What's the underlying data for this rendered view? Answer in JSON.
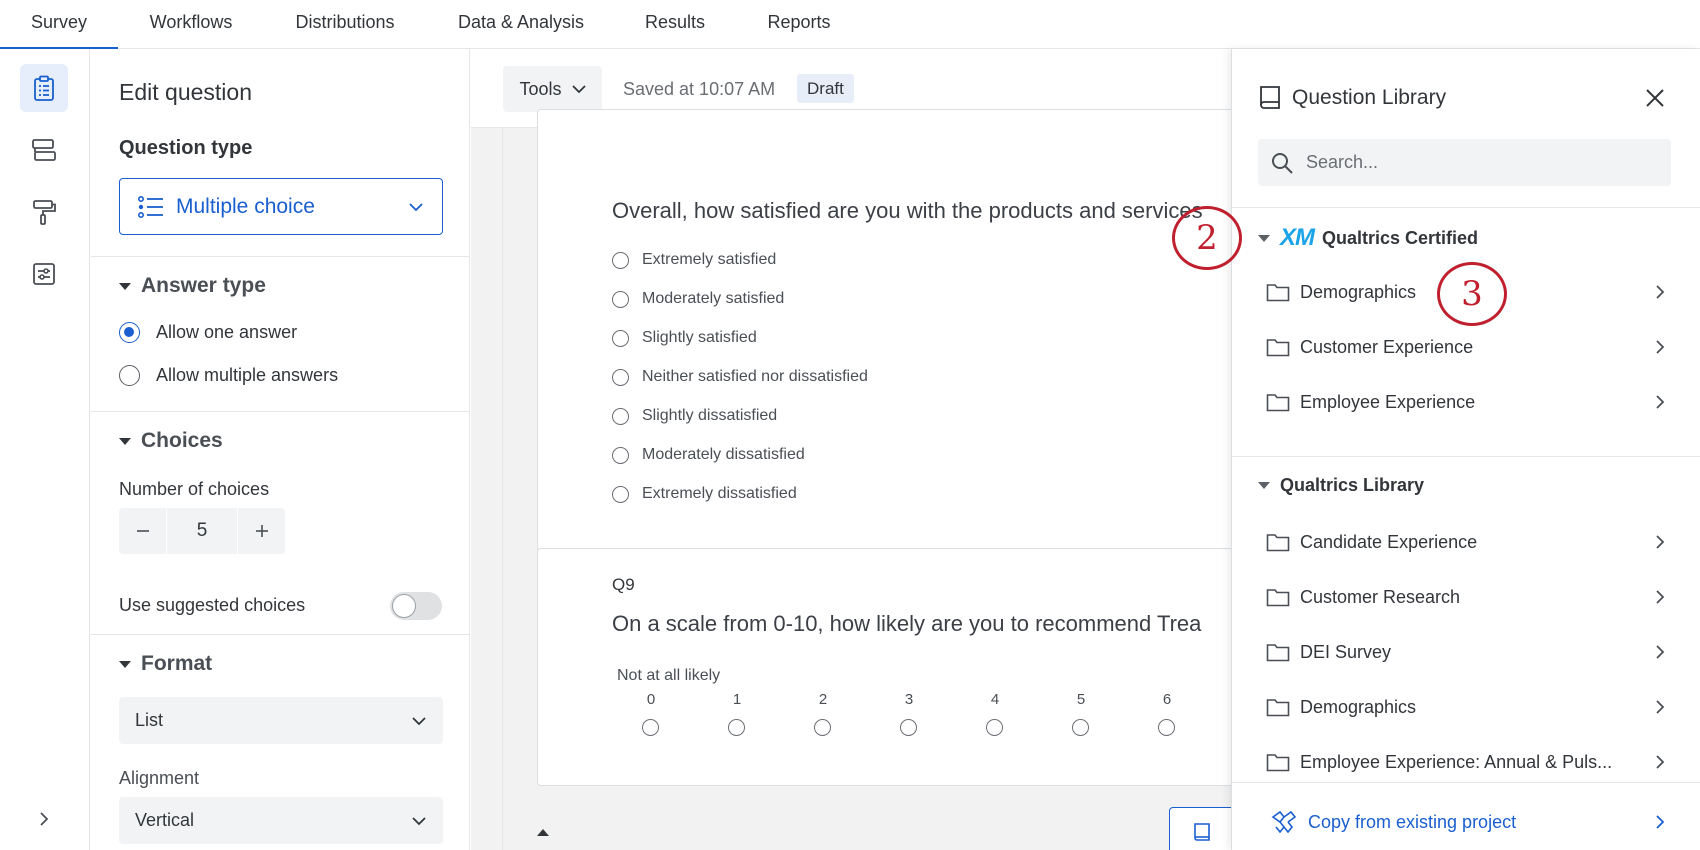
{
  "nav": {
    "tabs": [
      {
        "label": "Survey"
      },
      {
        "label": "Workflows"
      },
      {
        "label": "Distributions"
      },
      {
        "label": "Data & Analysis"
      },
      {
        "label": "Results"
      },
      {
        "label": "Reports"
      }
    ]
  },
  "edit": {
    "title": "Edit question",
    "question_type_label": "Question type",
    "question_type_value": "Multiple choice",
    "answer_type": {
      "heading": "Answer type",
      "options": [
        "Allow one answer",
        "Allow multiple answers"
      ],
      "selected": "Allow one answer"
    },
    "choices": {
      "heading": "Choices",
      "count_label": "Number of choices",
      "count_value": "5",
      "suggested_label": "Use suggested choices"
    },
    "format": {
      "heading": "Format",
      "value": "List",
      "alignment_label": "Alignment",
      "alignment_value": "Vertical"
    }
  },
  "toolbar": {
    "tools_label": "Tools",
    "saved_text": "Saved at 10:07 AM",
    "status_badge": "Draft"
  },
  "q8": {
    "text": "Overall, how satisfied are you with the products and services",
    "choices": [
      "Extremely satisfied",
      "Moderately satisfied",
      "Slightly satisfied",
      "Neither satisfied nor dissatisfied",
      "Slightly dissatisfied",
      "Moderately dissatisfied",
      "Extremely dissatisfied"
    ]
  },
  "q9": {
    "label": "Q9",
    "text": "On a scale from 0-10, how likely are you to recommend Trea",
    "scale_low_label": "Not at all likely",
    "scale_numbers": [
      "0",
      "1",
      "2",
      "3",
      "4",
      "5",
      "6"
    ]
  },
  "library": {
    "title": "Question Library",
    "search_placeholder": "Search...",
    "certified": {
      "logo": "XM",
      "heading": "Qualtrics Certified",
      "items": [
        "Demographics",
        "Customer Experience",
        "Employee Experience"
      ]
    },
    "qualtrics_library": {
      "heading": "Qualtrics Library",
      "items": [
        "Candidate Experience",
        "Customer Research",
        "DEI Survey",
        "Demographics",
        "Employee Experience: Annual & Puls..."
      ]
    },
    "copy_label": "Copy from existing project"
  },
  "annotations": [
    "2",
    "3"
  ],
  "colors": {
    "accent": "#1a5fcf",
    "annotation": "#c0202e",
    "xm_logo": "#1aa3e8"
  }
}
